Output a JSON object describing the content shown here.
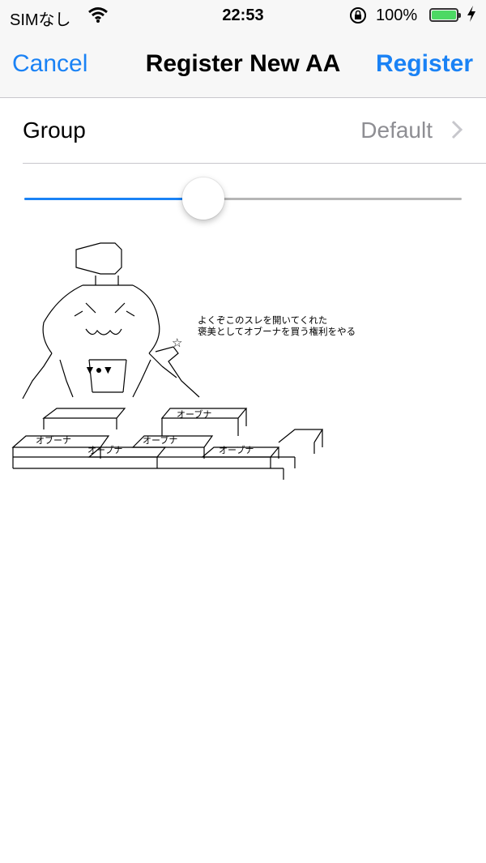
{
  "status_bar": {
    "carrier": "SIMなし",
    "time": "22:53",
    "battery_percent": "100%",
    "battery_level": 1.0,
    "icons": [
      "wifi-icon",
      "rotation-lock-icon",
      "battery-icon",
      "charging-bolt-icon"
    ]
  },
  "nav": {
    "cancel_label": "Cancel",
    "title": "Register New AA",
    "register_label": "Register"
  },
  "group": {
    "label": "Group",
    "value": "Default"
  },
  "slider": {
    "value": 0.41
  },
  "aa": {
    "caption_line1": "よくぞこのスレを開いてくれた",
    "caption_line2": "褒美としてオブーナを買う権利をやる",
    "box_label": "オーブナ",
    "box_label_left": "オブーナ",
    "face_tie": "▼●▼",
    "star": "☆"
  },
  "colors": {
    "accent": "#1a82f5",
    "secondary_text": "#8e8e93",
    "battery": "#4cd964"
  }
}
